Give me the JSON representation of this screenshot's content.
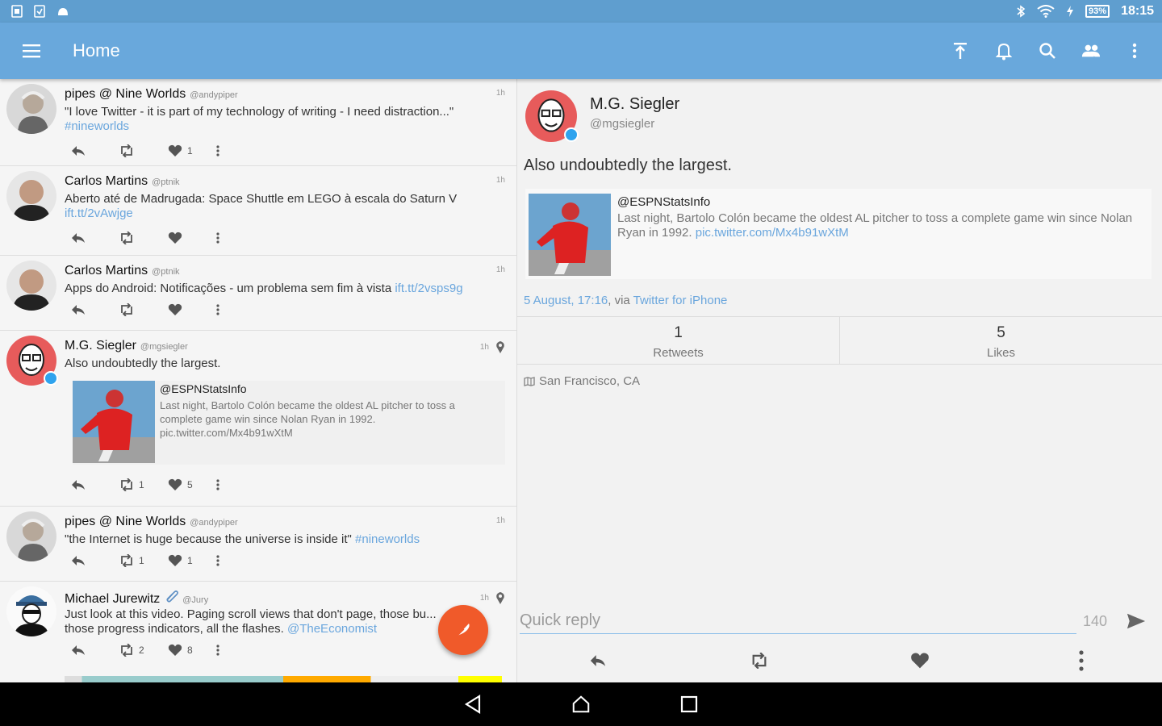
{
  "statusbar": {
    "battery": "93%",
    "clock": "18:15"
  },
  "appbar": {
    "title": "Home"
  },
  "timeline": [
    {
      "name": "pipes @ Nine Worlds",
      "handle": "@andypiper",
      "time": "1h",
      "text": "\"I love Twitter - it is part of my technology of writing - I need distraction...\"",
      "link": "#nineworlds",
      "retweets": "",
      "likes": "1"
    },
    {
      "name": "Carlos Martins",
      "handle": "@ptnik",
      "time": "1h",
      "text": "Aberto até de Madrugada: Space Shuttle em LEGO à escala do Saturn V ",
      "link": "ift.tt/2vAwjge",
      "retweets": "",
      "likes": ""
    },
    {
      "name": "Carlos Martins",
      "handle": "@ptnik",
      "time": "1h",
      "text": "Apps do Android: Notificações - um problema sem fim à vista ",
      "link": "ift.tt/2vsps9g",
      "retweets": "",
      "likes": ""
    },
    {
      "name": "M.G. Siegler",
      "handle": "@mgsiegler",
      "time": "1h",
      "text": "Also undoubtedly the largest.",
      "quote_name": "@ESPNStatsInfo",
      "quote_text": "Last night, Bartolo Colón became the oldest AL pitcher to toss a complete game win since Nolan Ryan in 1992. pic.twitter.com/Mx4b91wXtM",
      "retweets": "1",
      "likes": "5"
    },
    {
      "name": "pipes @ Nine Worlds",
      "handle": "@andypiper",
      "time": "1h",
      "text": "\"the Internet is huge because the universe is inside it\" ",
      "link": "#nineworlds",
      "retweets": "1",
      "likes": "1"
    },
    {
      "name": "Michael Jurewitz",
      "handle": "@Jury",
      "time": "1h",
      "text": "Just look at this video. Paging scroll views that don't page, those bu... those progress indicators, all the flashes. ",
      "link": "@TheEconomist",
      "retweets": "2",
      "likes": "8"
    }
  ],
  "detail": {
    "name": "M.G. Siegler",
    "handle": "@mgsiegler",
    "text": "Also undoubtedly the largest.",
    "quote_name": "@ESPNStatsInfo",
    "quote_text": "Last night, Bartolo Colón became the oldest AL pitcher to toss a complete game win since Nolan Ryan in 1992. ",
    "quote_link": "pic.twitter.com/Mx4b91wXtM",
    "date": "5 August, 17:16",
    "via": ", via ",
    "client": "Twitter for iPhone",
    "retweets": "1",
    "retweets_label": "Retweets",
    "likes": "5",
    "likes_label": "Likes",
    "location": "San Francisco, CA",
    "reply_placeholder": "Quick reply",
    "char_count": "140"
  },
  "colors": {
    "accent": "#69a8dc",
    "link": "#6aa6dd",
    "fab": "#f05a2a"
  }
}
